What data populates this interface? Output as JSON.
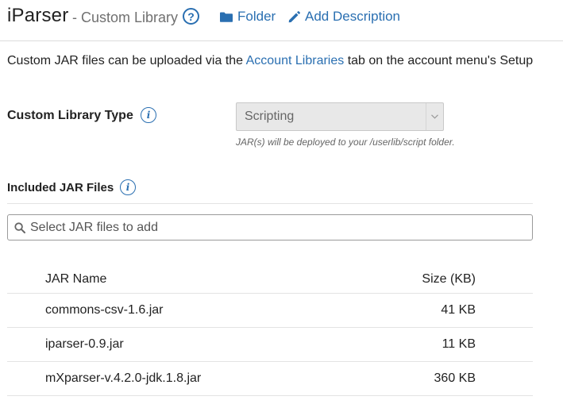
{
  "header": {
    "app_title": "iParser",
    "subtitle": "- Custom Library",
    "folder_label": "Folder",
    "add_description_label": "Add Description"
  },
  "info": {
    "prefix": "Custom JAR files can be uploaded via the ",
    "link_text": "Account Libraries",
    "suffix": " tab on the account menu's Setup"
  },
  "library_type": {
    "label": "Custom Library Type",
    "selected_value": "Scripting",
    "helper": "JAR(s) will be deployed to your /userlib/script folder."
  },
  "jar_section": {
    "title": "Included JAR Files",
    "search_placeholder": "Select JAR files to add"
  },
  "table": {
    "columns": [
      "JAR Name",
      "Size (KB)"
    ],
    "rows": [
      {
        "name": "commons-csv-1.6.jar",
        "size": "41 KB"
      },
      {
        "name": "iparser-0.9.jar",
        "size": "11 KB"
      },
      {
        "name": "mXparser-v.4.2.0-jdk.1.8.jar",
        "size": "360 KB"
      }
    ]
  },
  "colors": {
    "accent": "#2a6fb1",
    "text": "#222222",
    "muted": "#707070"
  },
  "icons": [
    "help-circle-icon",
    "folder-icon",
    "pencil-icon",
    "info-icon",
    "search-icon",
    "chevron-down-icon"
  ]
}
